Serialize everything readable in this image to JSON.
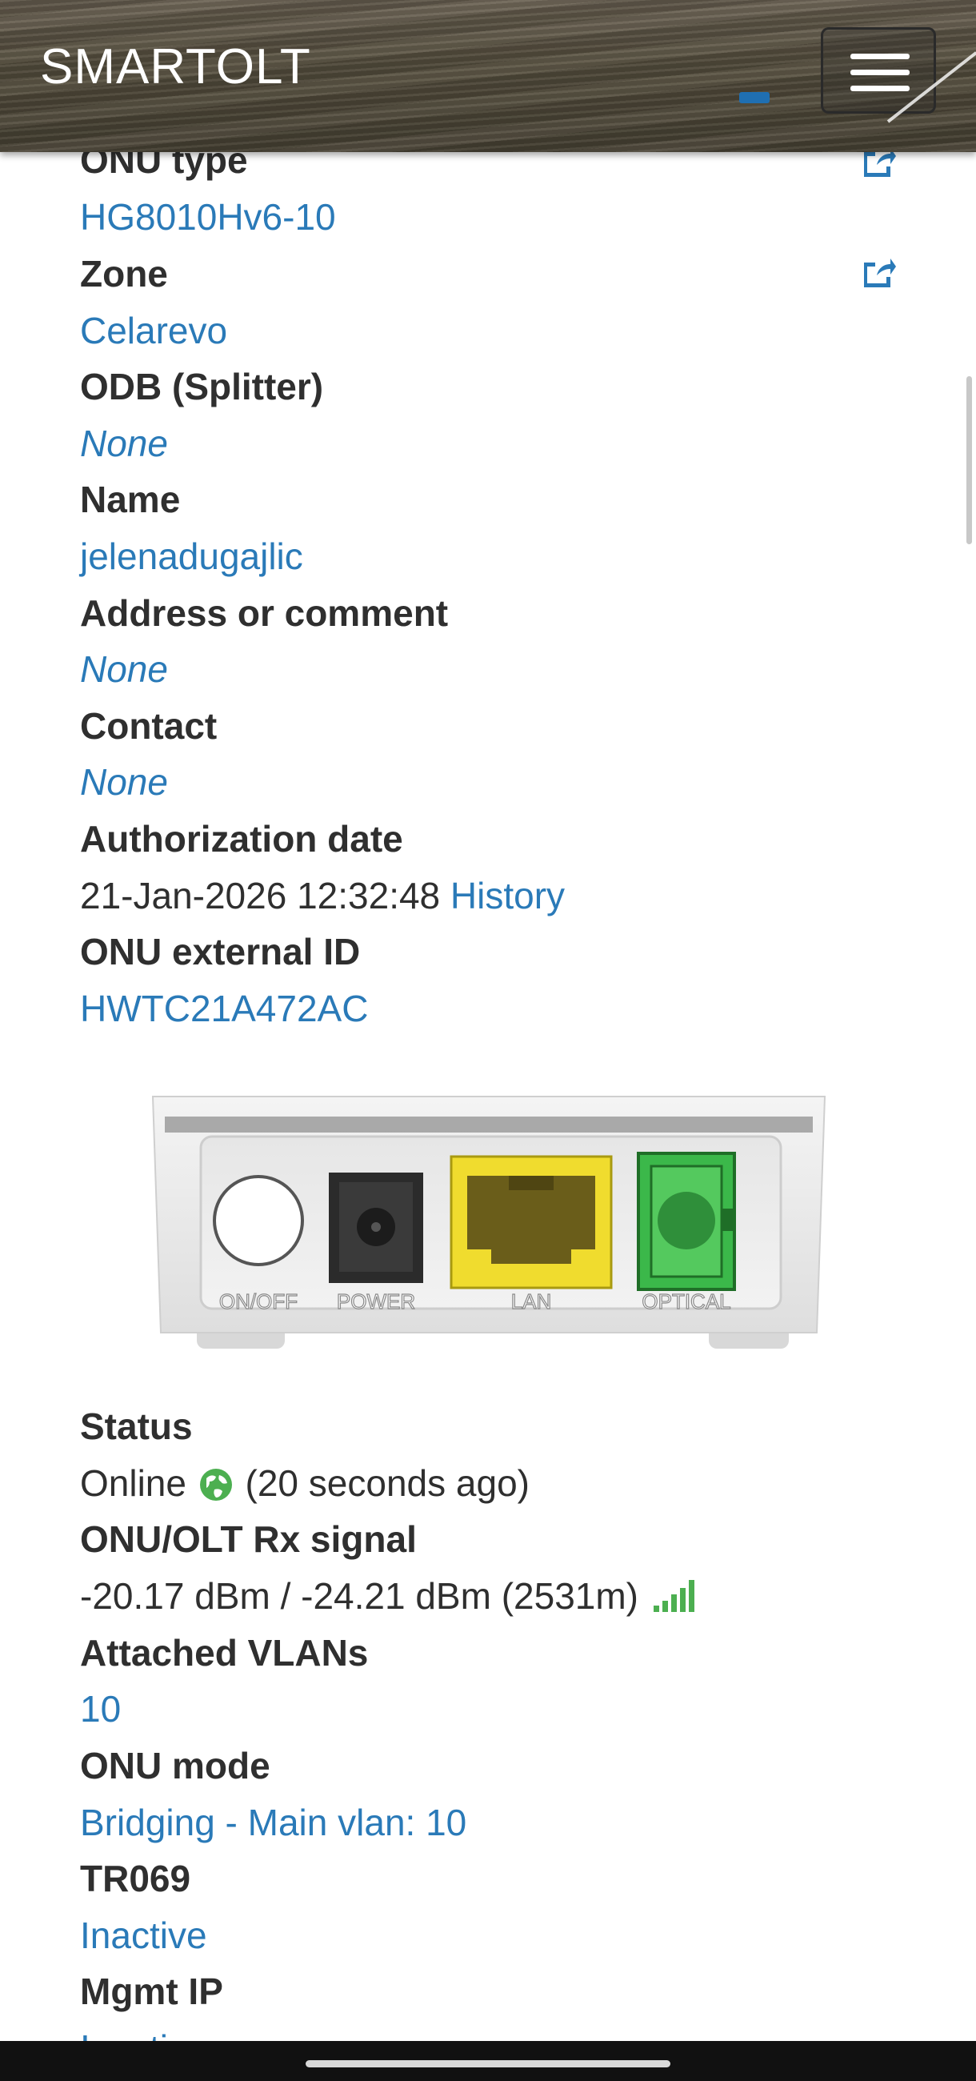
{
  "header": {
    "brand": "SMARTOLT",
    "menu_icon": "hamburger-menu-icon"
  },
  "fields": {
    "onu_type": {
      "label": "ONU type",
      "value": "HG8010Hv6-10"
    },
    "zone": {
      "label": "Zone",
      "value": "Celarevo"
    },
    "odb": {
      "label": "ODB (Splitter)",
      "value": "None"
    },
    "name": {
      "label": "Name",
      "value": "jelenadugajlic"
    },
    "address": {
      "label": "Address or comment",
      "value": "None"
    },
    "contact": {
      "label": "Contact",
      "value": "None"
    },
    "auth_date": {
      "label": "Authorization date",
      "value": "21-Jan-2026 12:32:48",
      "history_link": "History"
    },
    "external_id": {
      "label": "ONU external ID",
      "value": "HWTC21A472AC"
    },
    "status": {
      "label": "Status",
      "state": "Online",
      "ago": "(20 seconds ago)",
      "icon": "globe-icon",
      "color": "#4caf50"
    },
    "rx_signal": {
      "label": "ONU/OLT Rx signal",
      "value": "-20.17 dBm / -24.21 dBm (2531m)",
      "icon": "signal-bars-icon",
      "color": "#4caf50"
    },
    "vlans": {
      "label": "Attached VLANs",
      "value": "10"
    },
    "onu_mode": {
      "label": "ONU mode",
      "value": "Bridging - Main vlan: 10"
    },
    "tr069": {
      "label": "TR069",
      "value": "Inactive"
    },
    "mgmt_ip": {
      "label": "Mgmt IP",
      "value": "Inactive"
    }
  },
  "device": {
    "ports": [
      "ON/OFF",
      "POWER",
      "LAN",
      "OPTICAL"
    ]
  },
  "colors": {
    "link": "#2a7ab8",
    "label": "#2f2f2f",
    "lan_port": "#f0dc2e",
    "optical_port": "#3bb84a"
  }
}
